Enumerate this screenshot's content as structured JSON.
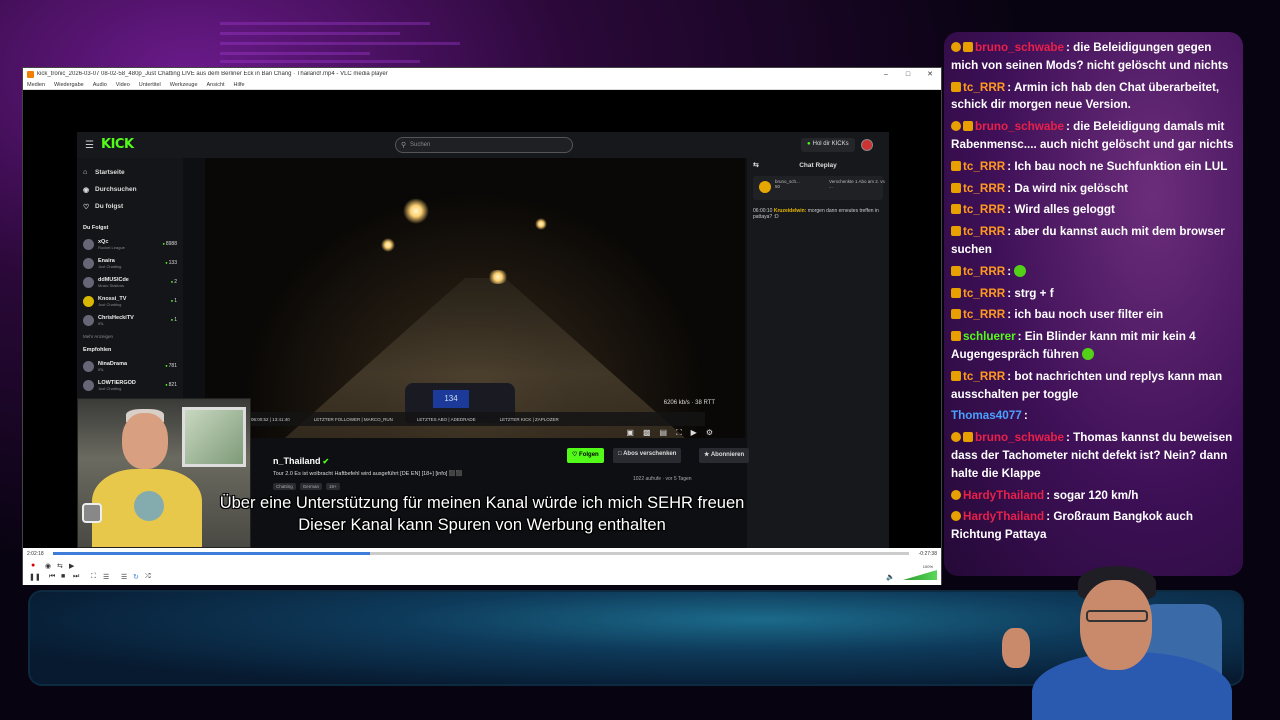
{
  "vlc": {
    "title": "kick_tronic_2026-03-07 08-02-58_480p_Just Chatting LIVE aus dem Berliner Eck in Ban Chang · Thailand!.mp4 - VLC media player",
    "menu": [
      "Medien",
      "Wiedergabe",
      "Audio",
      "Video",
      "Untertitel",
      "Werkzeuge",
      "Ansicht",
      "Hilfe"
    ],
    "time_elapsed": "2:02:18",
    "time_remaining": "-0:27:38",
    "progress_fraction": 0.37,
    "volume_label": "100%"
  },
  "kick": {
    "logo": "KICK",
    "search_placeholder": "Suchen",
    "cta": "Hol dir KICKs",
    "nav": [
      {
        "icon": "home-icon",
        "label": "Startseite"
      },
      {
        "icon": "compass-icon",
        "label": "Durchsuchen"
      },
      {
        "icon": "heart-icon",
        "label": "Du folgst"
      }
    ],
    "following_header": "Du Folgst",
    "following": [
      {
        "name": "xQc",
        "sub": "Rocket League",
        "viewers": "8988"
      },
      {
        "name": "Enaira",
        "sub": "Just Chatting",
        "viewers": "133"
      },
      {
        "name": "ddMUSICde",
        "sub": "Music Stations",
        "viewers": "2"
      },
      {
        "name": "Knossi_TV",
        "sub": "Just Chatting",
        "viewers": "1"
      },
      {
        "name": "ChrisHeckiTV",
        "sub": "IRL",
        "viewers": "1"
      }
    ],
    "more_label": "Mehr Anzeigen",
    "recommended_header": "Empfohlen",
    "recommended": [
      {
        "name": "NinaDrama",
        "sub": "IRL",
        "viewers": "781"
      },
      {
        "name": "LOWTIERGOD",
        "sub": "Just Chatting",
        "viewers": "821"
      }
    ],
    "chat_header": "Chat Replay",
    "pinned_user": "bruno_sch...",
    "pinned_count": "50",
    "pinned_note": "Verschenkte 1 Abo am 2. vs ...",
    "chat_msg_time": "06:00:10",
    "chat_msg_user": "Kruzeidelwin:",
    "chat_msg_text": "morgen dann erneutes treffen in pattaya? :D",
    "stream_stat": "6206 kb/s · 38 RTT",
    "dash_speed": "134",
    "overlay_items": [
      "LETZTER FOLLOWER | MARCO_RUN",
      "LETZTES ABO | ADEDRADE",
      "LETZTER KICK | ZAPLOZER",
      "LETZTER TIP | DAMLIESH"
    ],
    "overlay_time": "06:00:52 | 13:41:40",
    "channel_name": "n_Thailand",
    "stream_title": "Tour 2.0   Es ist wolbracht Haftbefehl wird ausgeführt  [DE EN] [18+] [info] ⬛⬛",
    "tags": [
      "Chatting",
      "German",
      "18+"
    ],
    "follow_label": "Folgen",
    "gift_label": "Abos verschenken",
    "subscribe_label": "Abonnieren",
    "stats": "1022 aufrufe · vor 5 Tagen"
  },
  "subtitles": {
    "line1": "Über eine Unterstützung für meinen Kanal würde ich mich SEHR freuen",
    "line2": "Dieser Kanal kann Spuren von Werbung enthalten"
  },
  "chat": [
    {
      "badges": [
        "one",
        "sub"
      ],
      "user": "bruno_schwabe",
      "ucls": "u-bruno",
      "text": "die Beleidigungen gegen mich von seinen Mods? nicht gelöscht und nichts"
    },
    {
      "badges": [
        "sub"
      ],
      "user": "tc_RRR",
      "ucls": "u-tc",
      "text": "Armin ich hab den Chat überarbeitet, schick dir morgen neue Version."
    },
    {
      "badges": [
        "one",
        "sub"
      ],
      "user": "bruno_schwabe",
      "ucls": "u-bruno",
      "text": "die Beleidigung damals mit Rabenmensc.... auch nicht gelöscht und gar nichts"
    },
    {
      "badges": [
        "sub"
      ],
      "user": "tc_RRR",
      "ucls": "u-tc",
      "text": "Ich bau noch ne Suchfunktion ein LUL"
    },
    {
      "badges": [
        "sub"
      ],
      "user": "tc_RRR",
      "ucls": "u-tc",
      "text": "Da wird nix gelöscht"
    },
    {
      "badges": [
        "sub"
      ],
      "user": "tc_RRR",
      "ucls": "u-tc",
      "text": "Wird alles geloggt"
    },
    {
      "badges": [
        "sub"
      ],
      "user": "tc_RRR",
      "ucls": "u-tc",
      "text": "aber du kannst auch mit dem browser suchen"
    },
    {
      "badges": [
        "sub"
      ],
      "user": "tc_RRR",
      "ucls": "u-tc",
      "text": "",
      "emoji": true
    },
    {
      "badges": [
        "sub"
      ],
      "user": "tc_RRR",
      "ucls": "u-tc",
      "text": "strg + f"
    },
    {
      "badges": [
        "sub"
      ],
      "user": "tc_RRR",
      "ucls": "u-tc",
      "text": "ich bau noch user filter ein"
    },
    {
      "badges": [
        "sub"
      ],
      "user": "schluerer",
      "ucls": "u-schluerer",
      "text": "Ein Blinder kann mit mir kein 4 Augengespräch führen",
      "emoji": true
    },
    {
      "badges": [
        "sub"
      ],
      "user": "tc_RRR",
      "ucls": "u-tc",
      "text": "bot nachrichten und replys kann man ausschalten per toggle"
    },
    {
      "badges": [],
      "user": "Thomas4077",
      "ucls": "u-thomas",
      "text": "",
      "emoji": false
    },
    {
      "badges": [
        "one",
        "sub"
      ],
      "user": "bruno_schwabe",
      "ucls": "u-bruno",
      "text": "Thomas kannst du beweisen dass der Tachometer nicht defekt ist? Nein? dann halte die Klappe"
    },
    {
      "badges": [
        "one"
      ],
      "user": "HardyThailand",
      "ucls": "u-hardy",
      "text": "sogar 120 km/h"
    },
    {
      "badges": [
        "one"
      ],
      "user": "HardyThailand",
      "ucls": "u-hardy",
      "text": "Großraum Bangkok auch Richtung Pattaya"
    }
  ]
}
